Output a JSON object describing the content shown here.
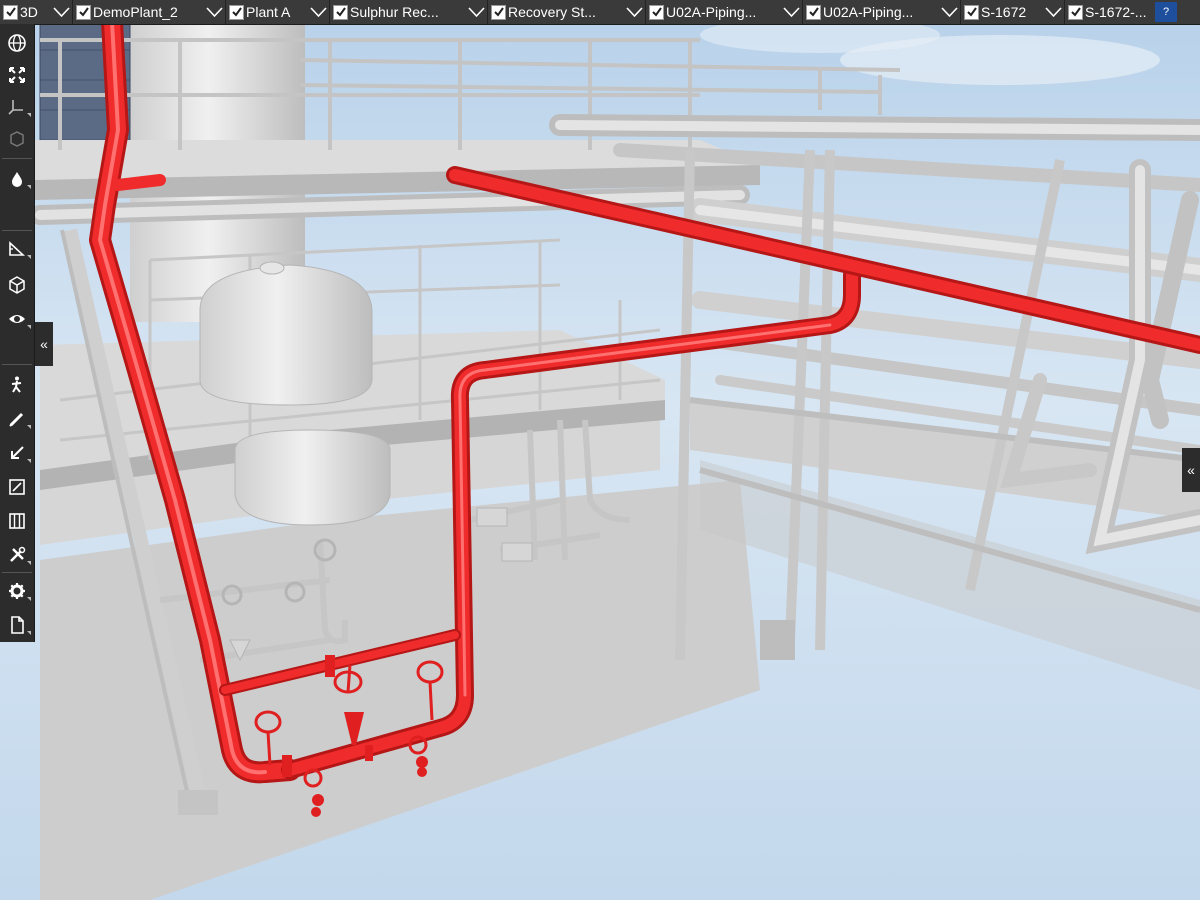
{
  "breadcrumbs": [
    {
      "label": "3D",
      "checked": true
    },
    {
      "label": "DemoPlant_2",
      "checked": true
    },
    {
      "label": "Plant A",
      "checked": true
    },
    {
      "label": "Sulphur Rec...",
      "checked": true
    },
    {
      "label": "Recovery St...",
      "checked": true
    },
    {
      "label": "U02A-Piping...",
      "checked": true
    },
    {
      "label": "U02A-Piping...",
      "checked": true
    },
    {
      "label": "S-1672",
      "checked": true
    },
    {
      "label": "S-1672-...",
      "checked": true
    }
  ],
  "help_label": "?",
  "toolbar": {
    "collapse_left": "«",
    "collapse_right": "«",
    "tools": [
      {
        "name": "globe-icon"
      },
      {
        "name": "fit-view-icon"
      },
      {
        "name": "axis-icon"
      },
      {
        "name": "section-box-icon"
      },
      {
        "name": "drop-icon"
      },
      {
        "name": "blank-tool"
      },
      {
        "name": "measure-icon"
      },
      {
        "name": "cube-icon"
      },
      {
        "name": "eye-icon"
      },
      {
        "name": "walk-icon"
      },
      {
        "name": "pencil-icon"
      },
      {
        "name": "arrow-icon"
      },
      {
        "name": "markup-icon"
      },
      {
        "name": "table-icon"
      },
      {
        "name": "tools-icon"
      },
      {
        "name": "gear-icon"
      },
      {
        "name": "document-icon"
      }
    ]
  },
  "colors": {
    "highlight_pipe": "#ef2b2b",
    "steel": "#d2d2d2",
    "sky": "#c9dcef",
    "toolbar_bg": "#2c2c2c"
  }
}
